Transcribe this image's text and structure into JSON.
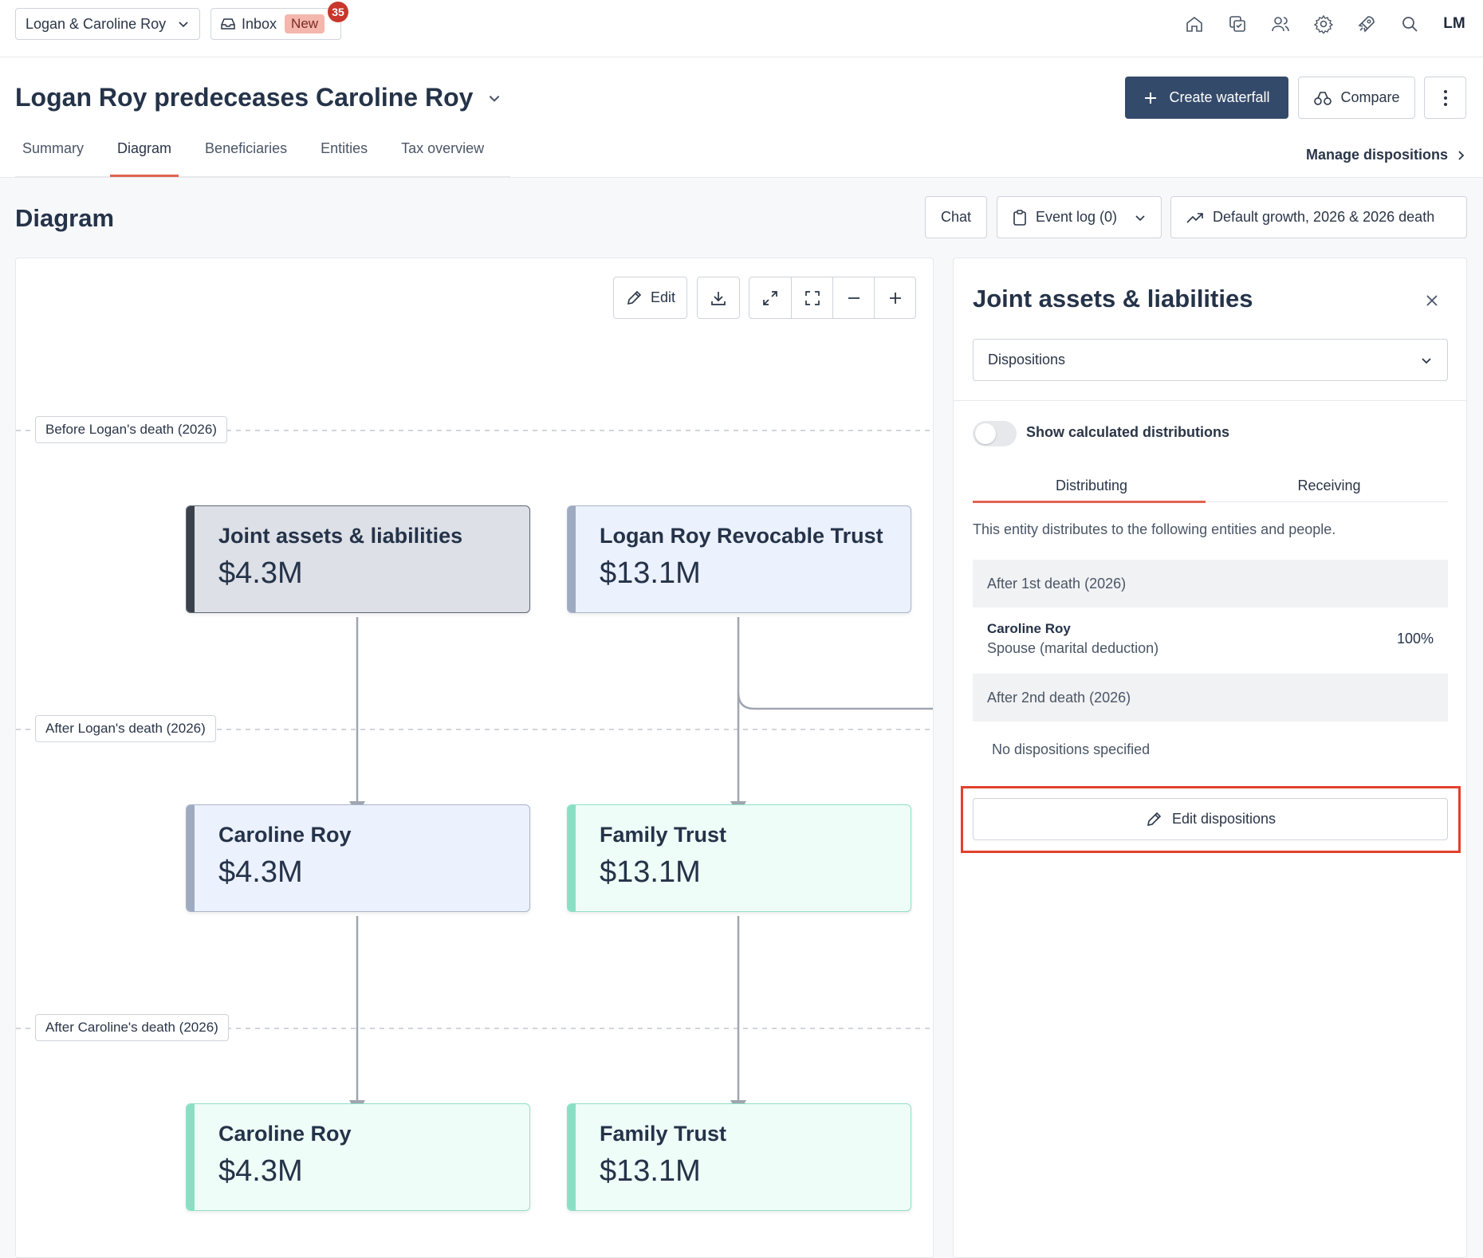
{
  "topbar": {
    "household": "Logan & Caroline Roy",
    "inbox_label": "Inbox",
    "inbox_new": "New",
    "inbox_count": "35",
    "icons": [
      "home-icon",
      "tasks-icon",
      "people-icon",
      "settings-icon",
      "rocket-icon",
      "search-icon"
    ],
    "avatar": "LM"
  },
  "header": {
    "title": "Logan Roy predeceases Caroline Roy",
    "create_waterfall": "Create waterfall",
    "compare": "Compare",
    "manage_dispositions": "Manage dispositions"
  },
  "tabs": [
    {
      "label": "Summary"
    },
    {
      "label": "Diagram",
      "active": true
    },
    {
      "label": "Beneficiaries"
    },
    {
      "label": "Entities"
    },
    {
      "label": "Tax overview"
    }
  ],
  "section": {
    "title": "Diagram",
    "chat": "Chat",
    "event_log": "Event log (0)",
    "growth": "Default growth, 2026 & 2026 death"
  },
  "diagram": {
    "edit": "Edit",
    "phases": [
      "Before Logan's death (2026)",
      "After Logan's death (2026)",
      "After Caroline's death (2026)"
    ],
    "nodes": {
      "joint": {
        "name": "Joint assets & liabilities",
        "value": "$4.3M"
      },
      "logan_trust": {
        "name": "Logan Roy Revocable Trust",
        "value": "$13.1M"
      },
      "caroline_1": {
        "name": "Caroline Roy",
        "value": "$4.3M"
      },
      "family_trust_1": {
        "name": "Family Trust",
        "value": "$13.1M"
      },
      "caroline_2": {
        "name": "Caroline Roy",
        "value": "$4.3M"
      },
      "family_trust_2": {
        "name": "Family Trust",
        "value": "$13.1M"
      }
    }
  },
  "panel": {
    "title": "Joint assets & liabilities",
    "select_value": "Dispositions",
    "toggle_label": "Show calculated distributions",
    "toggle_on": false,
    "tab_distributing": "Distributing",
    "tab_receiving": "Receiving",
    "description": "This entity distributes to the following entities and people.",
    "stage1": "After 1st death (2026)",
    "recipient_name": "Caroline Roy",
    "recipient_sub": "Spouse (marital deduction)",
    "recipient_pct": "100%",
    "stage2": "After 2nd death (2026)",
    "no_dispositions": "No dispositions specified",
    "edit_dispositions": "Edit dispositions",
    "highlight_color": "#e0412c"
  },
  "colors": {
    "primary": "#344a6a",
    "accent": "#e26350",
    "joint_node": "#dde0e6",
    "blue_node": "#ebf1fd",
    "green_node": "#effdf8"
  }
}
